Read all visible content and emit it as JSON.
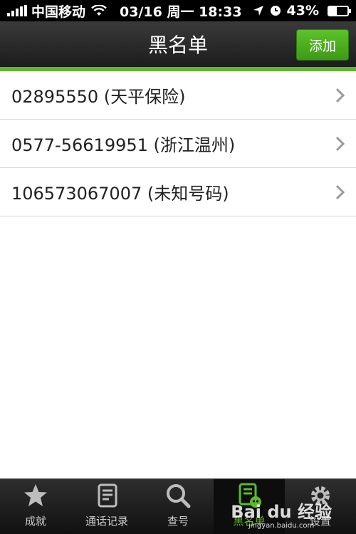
{
  "status_bar": {
    "carrier": "中国移动",
    "datetime": "03/16 周一 18:33",
    "battery": "43%",
    "battery_level": 0.43
  },
  "navbar": {
    "title": "黑名单",
    "add_label": "添加"
  },
  "blacklist": [
    {
      "label": "02895550 (天平保险)"
    },
    {
      "label": "0577-56619951 (浙江温州)"
    },
    {
      "label": "106573067007 (未知号码)"
    }
  ],
  "tabbar": {
    "tabs": [
      {
        "label": "成就",
        "icon": "star-icon"
      },
      {
        "label": "通话记录",
        "icon": "call-log-icon"
      },
      {
        "label": "查号",
        "icon": "search-icon"
      },
      {
        "label": "黑名单",
        "icon": "blacklist-icon",
        "active": true
      },
      {
        "label": "设置",
        "icon": "gear-icon"
      }
    ]
  },
  "watermark": {
    "brand": "Bai du 经验",
    "url": "jingyan.baidu.com"
  },
  "colors": {
    "accent": "#5db82d",
    "navbar": "#1c1c1c",
    "text": "#222222"
  }
}
